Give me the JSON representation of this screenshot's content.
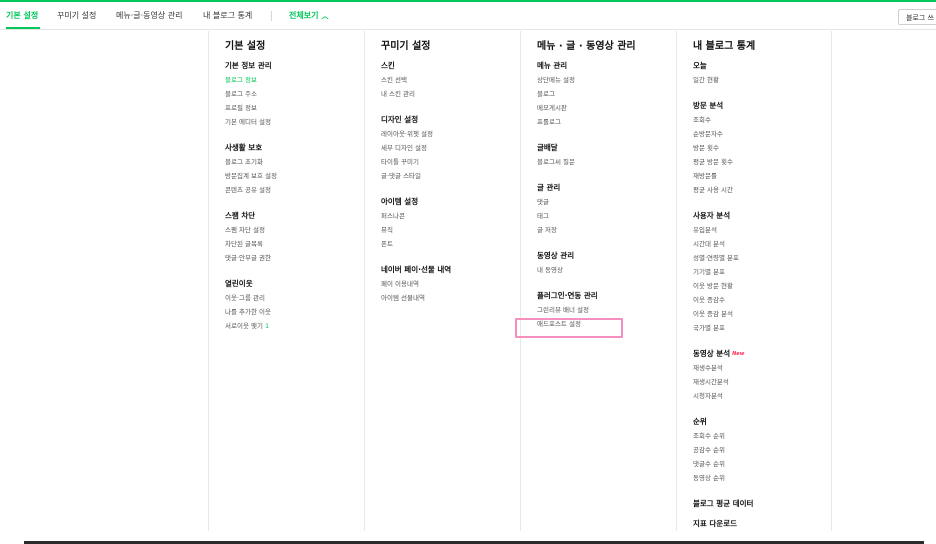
{
  "top_nav": {
    "tabs": [
      {
        "label": "기본 설정",
        "active": true
      },
      {
        "label": "꾸미기 설정",
        "active": false
      },
      {
        "label": "메뉴·글·동영상 관리",
        "active": false
      },
      {
        "label": "내 블로그 통계",
        "active": false
      }
    ],
    "all_view": "전체보기",
    "blog_button": "블로그 쓰"
  },
  "columns": [
    {
      "title": "기본 설정",
      "sections": [
        {
          "title": "기본 정보 관리",
          "items": [
            "블로그 정보",
            "블로그 주소",
            "프로필 정보",
            "기본 에디터 설정"
          ],
          "active_index": 0
        },
        {
          "title": "사생활 보호",
          "items": [
            "블로그 초기화",
            "방문집계 보호 설정",
            "콘텐츠 공유 설정"
          ]
        },
        {
          "title": "스팸 차단",
          "items": [
            "스팸 차단 설정",
            "차단된 글목록",
            "댓글·안부글 권한"
          ]
        },
        {
          "title": "열린이웃",
          "items": [
            "이웃·그룹 관리",
            "나를 추가한 이웃",
            "서로이웃 맺기"
          ],
          "counts": {
            "2": "1"
          }
        }
      ]
    },
    {
      "title": "꾸미기 설정",
      "sections": [
        {
          "title": "스킨",
          "items": [
            "스킨 선택",
            "내 스킨 관리"
          ]
        },
        {
          "title": "디자인 설정",
          "items": [
            "레이아웃·위젯 설정",
            "세부 디자인 설정",
            "타이틀 꾸미기",
            "글·댓글 스타일"
          ]
        },
        {
          "title": "아이템 설정",
          "items": [
            "퍼스나콘",
            "뮤직",
            "폰트"
          ]
        },
        {
          "title": "네이버 페이·선물 내역",
          "items": [
            "페이 이용내역",
            "아이템 선물내역"
          ]
        }
      ]
    },
    {
      "title": "메뉴 · 글 · 동영상 관리",
      "sections": [
        {
          "title": "메뉴 관리",
          "items": [
            "상단메뉴 설정",
            "블로그",
            "메모게시판",
            "프롤로그"
          ]
        },
        {
          "title": "글배달",
          "items": [
            "블로그씨 질문"
          ]
        },
        {
          "title": "글 관리",
          "items": [
            "댓글",
            "태그",
            "글 저장"
          ]
        },
        {
          "title": "동영상 관리",
          "items": [
            "내 동영상"
          ]
        },
        {
          "title": "플러그인·연동 관리",
          "items": [
            "그린리뷰 배너 설정",
            "애드포스트 설정"
          ]
        }
      ]
    },
    {
      "title": "내 블로그 통계",
      "sections": [
        {
          "title": "오늘",
          "items": [
            "일간 현황"
          ]
        },
        {
          "title": "방문 분석",
          "items": [
            "조회수",
            "순방문자수",
            "방문 횟수",
            "평균 방문 횟수",
            "재방문률",
            "평균 사용 시간"
          ]
        },
        {
          "title": "사용자 분석",
          "items": [
            "유입분석",
            "시간대 분석",
            "성별·연령별 분포",
            "기기별 분포",
            "이웃 방문 현황",
            "이웃 증감수",
            "이웃 증감 분석",
            "국가별 분포"
          ]
        },
        {
          "title": "동영상 분석",
          "items": [
            "재생수분석",
            "재생시간분석",
            "시청자분석"
          ],
          "badge": "New"
        },
        {
          "title": "순위",
          "items": [
            "조회수 순위",
            "공감수 순위",
            "댓글수 순위",
            "동영상 순위"
          ]
        },
        {
          "title": "블로그 평균 데이터",
          "items": []
        },
        {
          "title": "지표 다운로드",
          "items": []
        }
      ]
    }
  ],
  "colors": {
    "accent": "#03c75a",
    "highlight_box": "#f48fc0",
    "new_badge": "#ff2d55"
  }
}
